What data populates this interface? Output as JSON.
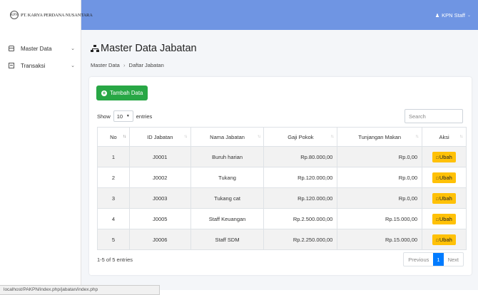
{
  "brand": {
    "logo_text": "KPN",
    "name": "PT. KARYA PERDANA NUSANTARA"
  },
  "user": {
    "name": "KPN Staff"
  },
  "sidebar": {
    "items": [
      {
        "label": "Master Data",
        "icon": "database-icon"
      },
      {
        "label": "Transaksi",
        "icon": "table-icon"
      }
    ]
  },
  "page": {
    "title": "Master Data Jabatan",
    "breadcrumb": {
      "parent": "Master Data",
      "separator": "›",
      "current": "Daftar Jabatan"
    }
  },
  "toolbar": {
    "add_label": "Tambah Data"
  },
  "table_controls": {
    "show_label": "Show",
    "page_size": "10",
    "entries_label": "entries",
    "search_placeholder": "Search"
  },
  "table": {
    "columns": [
      "No",
      "ID Jabatan",
      "Nama Jabatan",
      "Gaji Pokok",
      "Tunjangan Makan",
      "Aksi"
    ],
    "rows": [
      {
        "no": "1",
        "id": "J0001",
        "nama": "Buruh harian",
        "gaji": "Rp.80.000,00",
        "tunjangan": "Rp.0,00",
        "aksi": "Ubah"
      },
      {
        "no": "2",
        "id": "J0002",
        "nama": "Tukang",
        "gaji": "Rp.120.000,00",
        "tunjangan": "Rp.0,00",
        "aksi": "Ubah"
      },
      {
        "no": "3",
        "id": "J0003",
        "nama": "Tukang cat",
        "gaji": "Rp.120.000,00",
        "tunjangan": "Rp.0,00",
        "aksi": "Ubah"
      },
      {
        "no": "4",
        "id": "J0005",
        "nama": "Staff Keuangan",
        "gaji": "Rp.2.500.000,00",
        "tunjangan": "Rp.15.000,00",
        "aksi": "Ubah"
      },
      {
        "no": "5",
        "id": "J0006",
        "nama": "Staff SDM",
        "gaji": "Rp.2.250.000,00",
        "tunjangan": "Rp.15.000,00",
        "aksi": "Ubah"
      }
    ]
  },
  "footer": {
    "info": "1-5 of 5 entries",
    "previous": "Previous",
    "current_page": "1",
    "next": "Next"
  },
  "statusbar": {
    "url": "localhost/PAKPN/index.php/jabatan/index.php"
  },
  "colors": {
    "topbar": "#6f95e3",
    "add_button": "#28a745",
    "edit_button": "#ffc107",
    "pager_active": "#007bff"
  }
}
